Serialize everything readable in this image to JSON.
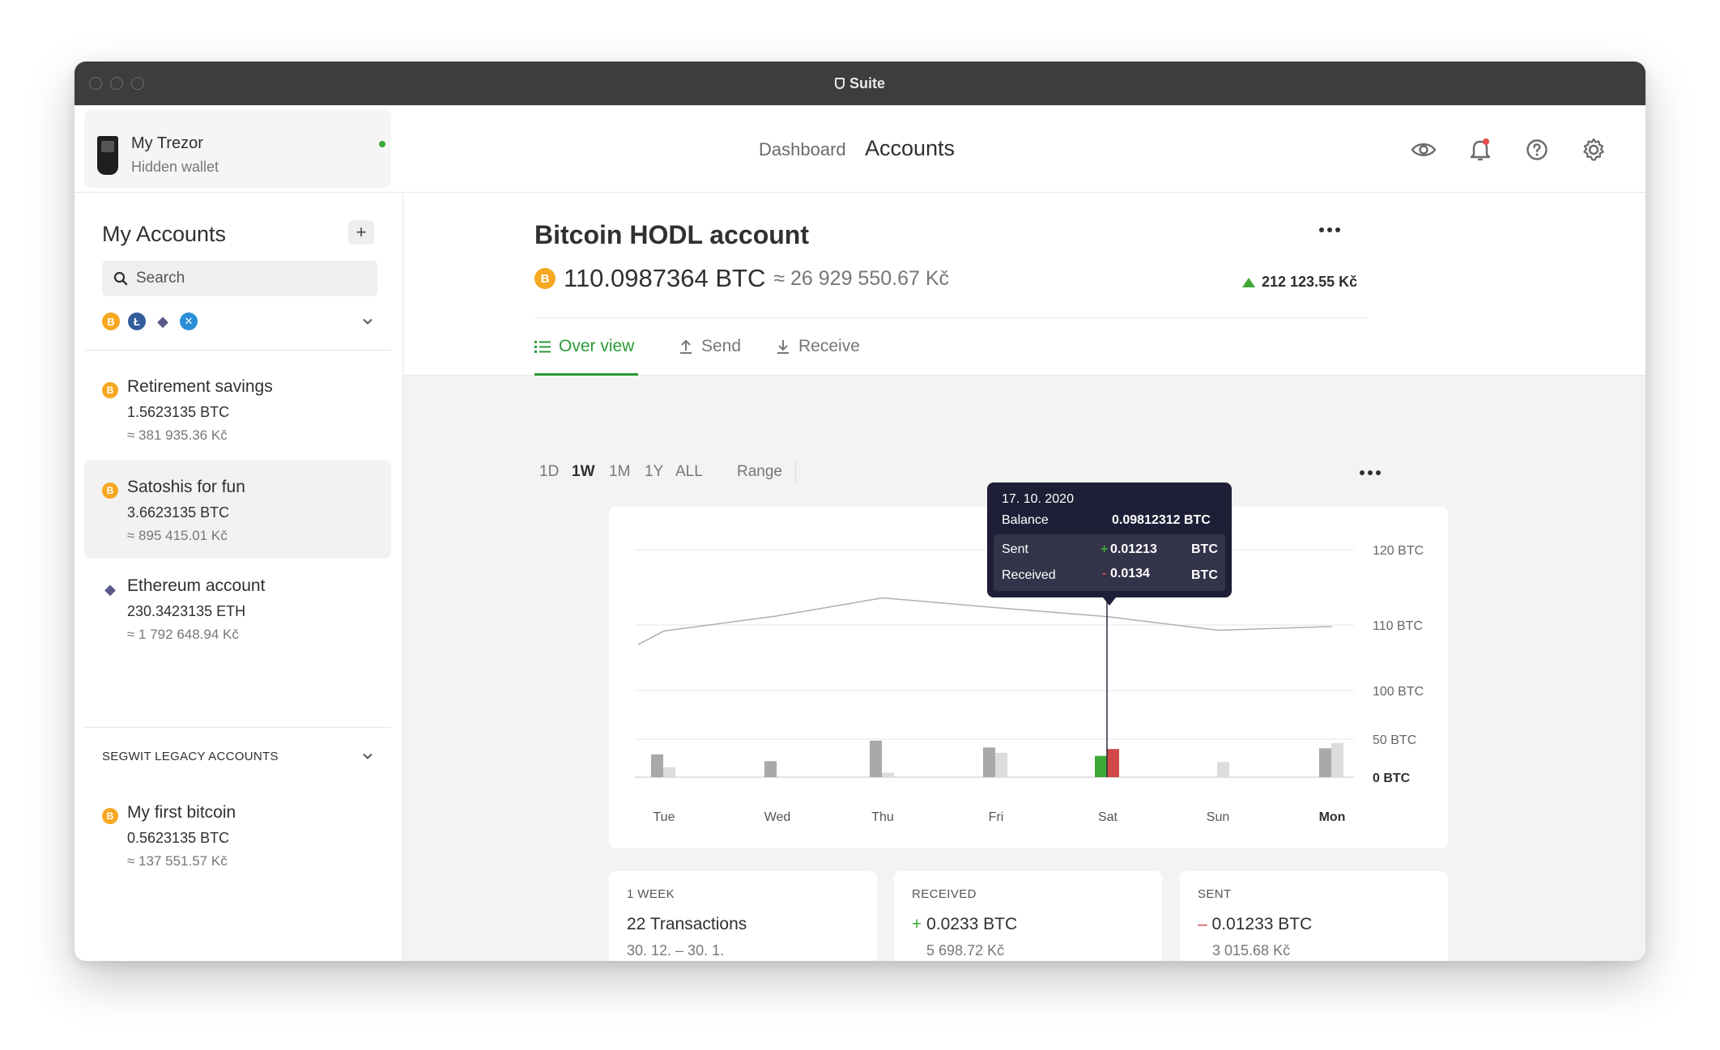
{
  "window": {
    "title": "Suite"
  },
  "device": {
    "name": "My Trezor",
    "subtitle": "Hidden wallet"
  },
  "nav": {
    "dashboard": "Dashboard",
    "accounts": "Accounts"
  },
  "sidebar": {
    "title": "My Accounts",
    "add_label": "+",
    "search_placeholder": "Search",
    "coins": [
      "B",
      "Ł",
      "◆",
      "✕"
    ],
    "accounts": [
      {
        "name": "Retirement savings",
        "balance": "1.5623135 BTC",
        "fiat": "≈ 381 935.36 Kč",
        "coin": "B"
      },
      {
        "name": "Satoshis for fun",
        "balance": "3.6623135 BTC",
        "fiat": "≈ 895 415.01 Kč",
        "coin": "B"
      },
      {
        "name": "Ethereum account",
        "balance": "230.3423135 ETH",
        "fiat": "≈ 1 792 648.94 Kč",
        "coin": "◆"
      }
    ],
    "legacy_section": "SEGWIT LEGACY ACCOUNTS",
    "legacy_accounts": [
      {
        "name": "My first bitcoin",
        "balance": "0.5623135 BTC",
        "fiat": "≈ 137 551.57 Kč",
        "coin": "B"
      }
    ]
  },
  "account": {
    "title": "Bitcoin HODL account",
    "balance": "110.0987364 BTC",
    "fiat": "≈ 26 929 550.67 Kč",
    "change": "212 123.55 Kč",
    "coin": "B"
  },
  "tabs": {
    "overview": "Over view",
    "send": "Send",
    "receive": "Receive"
  },
  "ranges": {
    "d1": "1D",
    "w1": "1W",
    "m1": "1M",
    "y1": "1Y",
    "all": "ALL",
    "range": "Range"
  },
  "tooltip": {
    "date": "17. 10. 2020",
    "balance_label": "Balance",
    "balance_value": "0.09812312 BTC",
    "sent_label": "Sent",
    "sent_value": "0.01213",
    "sent_sign": "+",
    "received_label": "Received",
    "received_value": "0.0134",
    "received_sign": "-",
    "unit": "BTC"
  },
  "stats": {
    "week": {
      "caption": "1 WEEK",
      "value": "22 Transactions",
      "sub": "30. 12. – 30. 1."
    },
    "received": {
      "caption": "RECEIVED",
      "sign": "+",
      "value": "0.0233 BTC",
      "sub": "5 698.72 Kč"
    },
    "sent": {
      "caption": "SENT",
      "sign": "–",
      "value": "0.01233 BTC",
      "sub": "3 015.68 Kč"
    }
  },
  "colors": {
    "accent": "#2b9a36",
    "btc": "#f6a821",
    "received": "#3ea835",
    "sent": "#d04848",
    "tooltip": "#1e1e37"
  },
  "chart_data": {
    "type": "bar",
    "categories": [
      "Tue",
      "Wed",
      "Thu",
      "Fri",
      "Sat",
      "Sun",
      "Mon"
    ],
    "highlight_category": "Sat",
    "bold_category": "Mon",
    "y_ticks": [
      "120 BTC",
      "110 BTC",
      "100 BTC",
      "50 BTC",
      "0 BTC"
    ],
    "series": [
      {
        "values": [
          30,
          21,
          48,
          39,
          28,
          0,
          38
        ]
      },
      {
        "values": [
          13,
          0,
          6,
          32,
          37,
          20,
          45
        ]
      }
    ],
    "balance_line": [
      109.2,
      111.2,
      113.6,
      112.3,
      111.1,
      109.3,
      109.8
    ]
  }
}
